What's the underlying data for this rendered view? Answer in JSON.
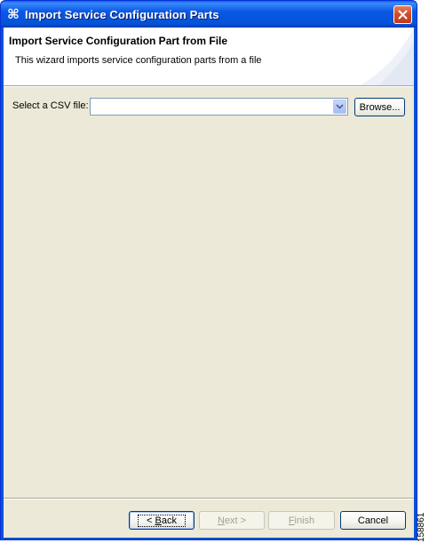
{
  "window": {
    "title": "Import Service Configuration Parts",
    "icon": "app-icon",
    "close_icon": "close-icon"
  },
  "banner": {
    "title": "Import Service Configuration Part from File",
    "description": "This wizard imports service configuration parts from a file"
  },
  "form": {
    "csv_label": "Select a CSV file:",
    "csv_value": "",
    "browse_label": "Browse..."
  },
  "buttons": {
    "back_prefix": "< ",
    "back_mnemonic": "B",
    "back_rest": "ack",
    "next_mnemonic": "N",
    "next_rest": "ext >",
    "finish_mnemonic": "F",
    "finish_rest": "inish",
    "cancel_label": "Cancel"
  },
  "figure_number": "158861",
  "colors": {
    "titlebar": "#0a58e5",
    "client_bg": "#ece9d8",
    "disabled_text": "#a1a192"
  }
}
